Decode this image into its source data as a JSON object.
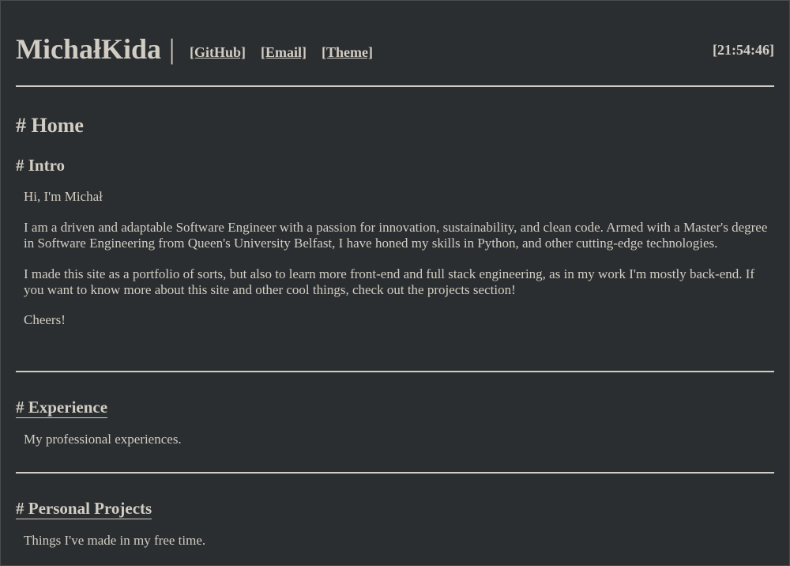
{
  "header": {
    "title": "MichałKida",
    "separator": "|",
    "nav": {
      "github": "[GitHub]",
      "email": "[Email]",
      "theme": "[Theme]"
    },
    "clock": "[21:54:46]"
  },
  "page_title": "# Home",
  "intro": {
    "heading": "# Intro",
    "greeting": "Hi, I'm Michał",
    "paragraph1": "I am a driven and adaptable Software Engineer with a passion for innovation, sustainability, and clean code. Armed with a Master's degree in Software Engineering from Queen's University Belfast, I have honed my skills in Python, and other cutting-edge technologies.",
    "paragraph2": "I made this site as a portfolio of sorts, but also to learn more front-end and full stack engineering, as in my work I'm mostly back-end. If you want to know more about this site and other cool things, check out the projects section!",
    "signoff": "Cheers!"
  },
  "experience": {
    "heading": "# Experience",
    "description": "My professional experiences."
  },
  "projects": {
    "heading": "# Personal Projects",
    "description": "Things I've made in my free time."
  }
}
